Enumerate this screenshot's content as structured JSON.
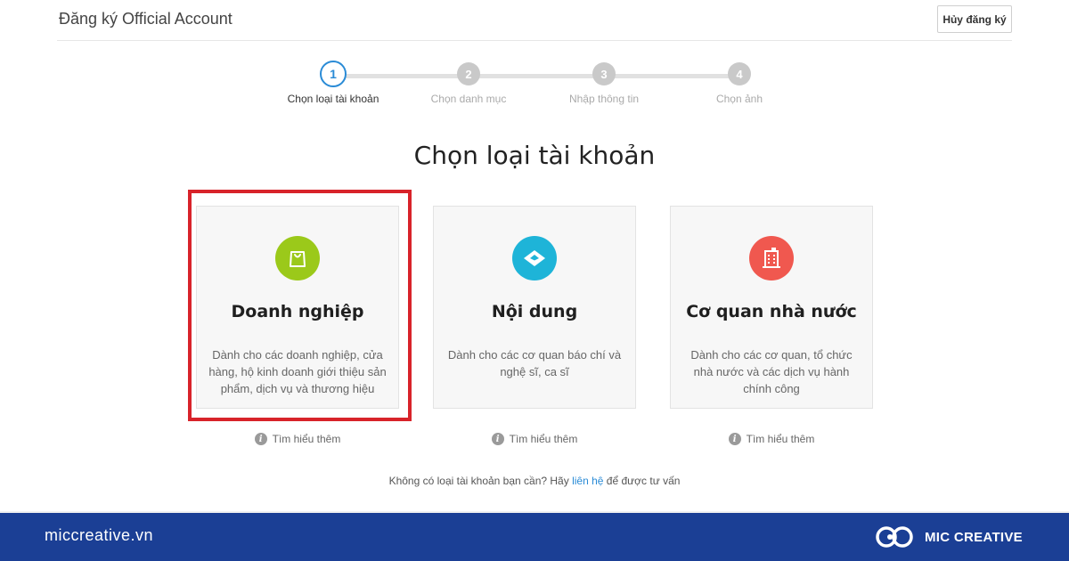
{
  "header": {
    "title": "Đăng ký Official Account",
    "cancel_label": "Hủy đăng ký"
  },
  "stepper": {
    "steps": [
      {
        "number": "1",
        "label": "Chọn loại tài khoản",
        "state": "active"
      },
      {
        "number": "2",
        "label": "Chọn danh mục",
        "state": "inactive"
      },
      {
        "number": "3",
        "label": "Nhập thông tin",
        "state": "inactive"
      },
      {
        "number": "4",
        "label": "Chọn ảnh",
        "state": "inactive"
      }
    ]
  },
  "main": {
    "heading": "Chọn loại tài khoản",
    "cards": [
      {
        "title": "Doanh nghiệp",
        "desc": "Dành cho các doanh nghiệp, cửa hàng, hộ kinh doanh giới thiệu sản phẩm, dịch vụ và thương hiệu",
        "icon": "shopping-bag-icon",
        "icon_color": "#9bc91a",
        "selected": true
      },
      {
        "title": "Nội dung",
        "desc": "Dành cho các cơ quan báo chí và nghệ sĩ, ca sĩ",
        "icon": "content-icon",
        "icon_color": "#1eb4d8",
        "selected": false
      },
      {
        "title": "Cơ quan nhà nước",
        "desc": "Dành cho các cơ quan, tổ chức nhà nước và các dịch vụ hành chính công",
        "icon": "building-icon",
        "icon_color": "#f0584f",
        "selected": false
      }
    ],
    "learn_more_label": "Tìm hiểu thêm",
    "footnote": {
      "prefix": "Không có loại tài khoản bạn cần? Hãy ",
      "link": "liên hệ",
      "suffix": " để được tư vấn"
    }
  },
  "footer_bar": {
    "site": "miccreative.vn",
    "brand": "MIC CREATIVE"
  },
  "colors": {
    "accent": "#2a8bd6",
    "highlight": "#d8232a",
    "footer_bg": "#1b3f95"
  }
}
